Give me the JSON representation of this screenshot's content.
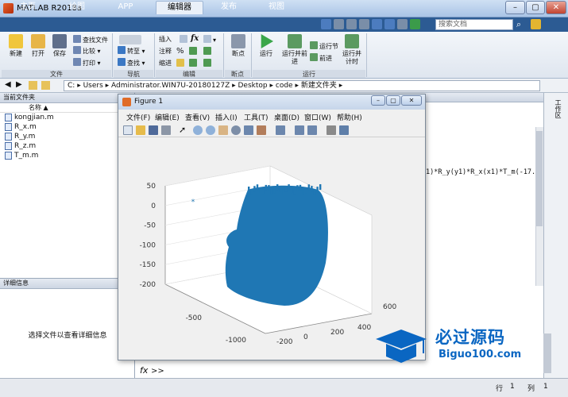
{
  "window": {
    "title": "MATLAB R2018a",
    "min_label": "–",
    "max_label": "▢",
    "close_label": "✕"
  },
  "tabs": [
    "主页",
    "绘图",
    "APP",
    "编辑器",
    "发布",
    "视图"
  ],
  "search": {
    "placeholder": "搜索文档"
  },
  "ribbon": {
    "file": {
      "new": "新建",
      "open": "打开",
      "save": "保存",
      "find_files": "查找文件",
      "compare": "比较",
      "print": "打印",
      "label": "文件"
    },
    "navigate": {
      "goto": "转至",
      "find": "查找",
      "label": "导航"
    },
    "edit": {
      "insert": "插入",
      "comment": "注释",
      "indent": "缩进",
      "fx": "fx",
      "label": "编辑"
    },
    "breakpoints": {
      "breakpoints": "断点",
      "label": "断点"
    },
    "run": {
      "run": "运行",
      "run_advance": "运行并前进",
      "run_section": "运行节",
      "advance": "前进",
      "run_time": "运行并计时",
      "label": "运行"
    }
  },
  "address": {
    "parts": [
      "C:",
      "Users",
      "Administrator.WIN7U-20180127Z",
      "Desktop",
      "code",
      "新建文件夹"
    ]
  },
  "current_folder": {
    "title": "当前文件夹",
    "name_header": "名称 ▲",
    "files": [
      "kongjian.m",
      "R_x.m",
      "R_y.m",
      "R_z.m",
      "T_m.m"
    ]
  },
  "details": {
    "title": "详细信息",
    "empty_text": "选择文件以查看详细信息"
  },
  "command": {
    "code_line": "1)*R_y(y1)*R_x(x1)*T_m(-17.5,",
    "fx": "fx",
    "prompt": ">>"
  },
  "right_panel_label": "工作区",
  "status": {
    "row_label": "行",
    "row": "1",
    "col_label": "列",
    "col": "1"
  },
  "figure": {
    "title": "Figure 1",
    "menu": [
      "文件(F)",
      "编辑(E)",
      "查看(V)",
      "插入(I)",
      "工具(T)",
      "桌面(D)",
      "窗口(W)",
      "帮助(H)"
    ]
  },
  "chart_data": {
    "type": "scatter",
    "title": "",
    "z_ticks": [
      "50",
      "0",
      "-50",
      "-100",
      "-150",
      "-200"
    ],
    "x_ticks": [
      "-500",
      "-1000"
    ],
    "y_ticks": [
      "-200",
      "0",
      "200",
      "400",
      "600"
    ],
    "zlim": [
      -200,
      50
    ],
    "grid": true,
    "marker_color": "#1f77b4",
    "series": [
      {
        "values": [
          {
            "x": -550,
            "y": -150,
            "z": 20
          }
        ]
      },
      {
        "values": [
          {
            "x": -800,
            "y": 100,
            "z": 40
          },
          {
            "x": -700,
            "y": 300,
            "z": 40
          },
          {
            "x": -900,
            "y": 100,
            "z": -180
          },
          {
            "x": -600,
            "y": 400,
            "z": -120
          }
        ]
      }
    ]
  },
  "logo": {
    "name": "必过源码",
    "url": "Biguo100.com"
  },
  "colors": {
    "ribbon_tab_bar": "#2c5b93",
    "accent": "#1f77b4"
  }
}
